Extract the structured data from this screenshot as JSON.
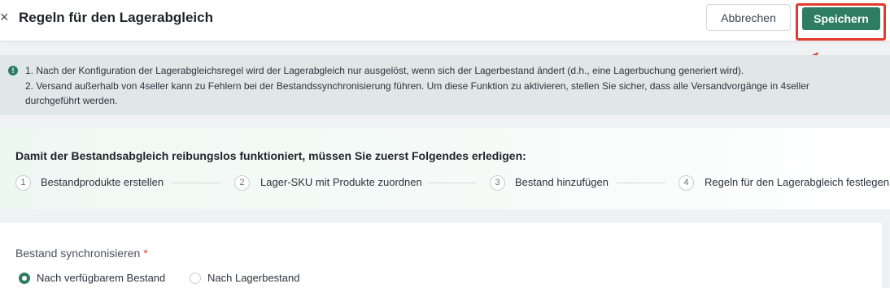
{
  "header": {
    "title": "Regeln für den Lagerabgleich",
    "close_label": "×",
    "cancel_label": "Abbrechen",
    "save_label": "Speichern"
  },
  "notice": {
    "lines": [
      "1. Nach der Konfiguration der Lagerabgleichsregel wird der Lagerabgleich nur ausgelöst, wenn sich der Lagerbestand ändert (d.h., eine Lagerbuchung generiert wird).",
      "2. Versand außerhalb von 4seller kann zu Fehlern bei der Bestandssynchronisierung führen. Um diese Funktion zu aktivieren, stellen Sie sicher, dass alle Versandvorgänge in 4seller",
      "durchgeführt werden."
    ]
  },
  "steps": {
    "title": "Damit der Bestandsabgleich reibungslos funktioniert, müssen Sie zuerst Folgendes erledigen:",
    "items": [
      {
        "number": "1",
        "label": "Bestandprodukte erstellen"
      },
      {
        "number": "2",
        "label": "Lager-SKU mit Produkte zuordnen"
      },
      {
        "number": "3",
        "label": "Bestand hinzufügen"
      },
      {
        "number": "4",
        "label": "Regeln für den Lagerabgleich festlegen"
      }
    ]
  },
  "sync": {
    "label": "Bestand synchronisieren",
    "required_mark": "*",
    "options": [
      {
        "label": "Nach verfügbarem Bestand",
        "selected": true
      },
      {
        "label": "Nach Lagerbestand",
        "selected": false
      }
    ]
  },
  "colors": {
    "primary": "#2e7d62",
    "annotation": "#e23b2e",
    "notice_bg": "#dfe8e6"
  }
}
